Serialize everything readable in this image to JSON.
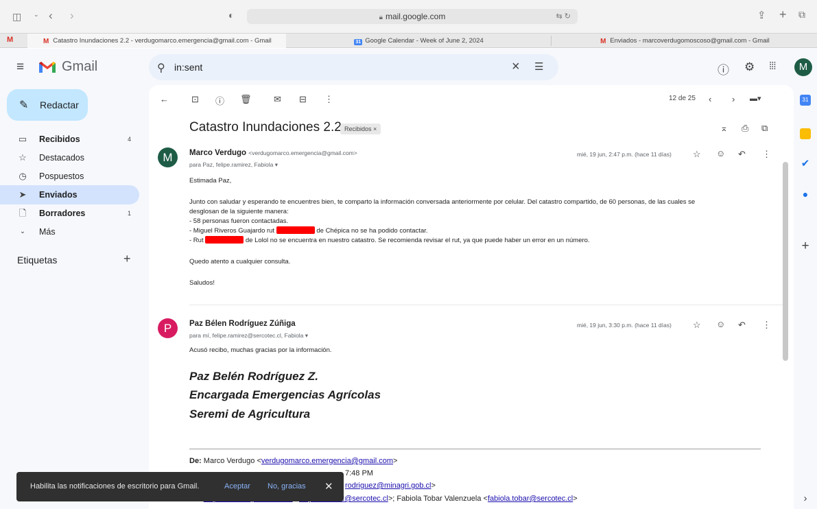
{
  "browser": {
    "url": "mail.google.com",
    "tabs": [
      {
        "title": "Catastro Inundaciones 2.2 - verdugomarco.emergencia@gmail.com - Gmail"
      },
      {
        "title": "Google Calendar - Week of June 2, 2024"
      },
      {
        "title": "Enviados - marcoverdugomoscoso@gmail.com - Gmail"
      }
    ]
  },
  "gmail": {
    "app_name": "Gmail",
    "search_query": "in:sent",
    "account_initial": "M",
    "compose_label": "Redactar",
    "nav": [
      {
        "label": "Recibidos",
        "count": "4"
      },
      {
        "label": "Destacados",
        "count": ""
      },
      {
        "label": "Pospuestos",
        "count": ""
      },
      {
        "label": "Enviados",
        "count": ""
      },
      {
        "label": "Borradores",
        "count": "1"
      },
      {
        "label": "Más",
        "count": ""
      }
    ],
    "labels_header": "Etiquetas"
  },
  "thread": {
    "pagination": "12 de 25",
    "subject": "Catastro Inundaciones 2.2",
    "label_badge": "Recibidos ×",
    "messages": [
      {
        "initial": "M",
        "avatar_color": "#1e5c46",
        "sender_name": "Marco Verdugo",
        "sender_email": "<verdugomarco.emergencia@gmail.com>",
        "to": "para Paz, felipe.ramirez, Fabiola",
        "date": "mié, 19 jun, 2:47 p.m. (hace 11 días)",
        "greeting": "Estimada Paz,",
        "para1": "Junto con saludar y esperando te encuentres bien, te comparto la información conversada anteriormente por celular. Del catastro compartido, de 60 personas, de las cuales se",
        "para1b": "desglosan de la siguiente manera:",
        "bullet1": "- 58 personas fueron contactadas.",
        "bullet2_a": "- Miguel Riveros Guajardo rut",
        "bullet2_b": "de Chépica no se ha podido contactar.",
        "bullet3_a": "- Rut",
        "bullet3_b": "de Lolol no se encuentra en nuestro catastro. Se recomienda revisar el rut, ya que puede haber un error en un número.",
        "closing": "Quedo atento a cualquier consulta.",
        "signoff": "Saludos!"
      },
      {
        "initial": "P",
        "avatar_color": "#d81b60",
        "sender_name": "Paz Bélen Rodríguez Zúñiga",
        "to": "para mí, felipe.ramirez@sercotec.cl, Fabiola",
        "date": "mié, 19 jun, 3:30 p.m. (hace 11 días)",
        "text": "Acusó recibo, muchas gracias por la información.",
        "sig1": "Paz Belén Rodríguez Z.",
        "sig2": "Encargada Emergencias Agrícolas",
        "sig3": "Seremi de Agricultura",
        "quoted_from_label": "De:",
        "quoted_from_name": "Marco Verdugo <",
        "quoted_from_email": "verdugomarco.emergencia@gmail.com",
        "quoted_from_end": ">",
        "quoted_time": "7:48 PM",
        "quoted_to_email": "rodriguez@minagri.gob.cl",
        "quoted_to_end": ">",
        "quoted_cc_label": "Cc:",
        "quoted_cc_email1": "felipe.ramirez@sercotec.cl",
        "quoted_cc_mid": ">; Fabiola Tobar Valenzuela <",
        "quoted_cc_email2": "fabiola.tobar@sercotec.cl",
        "quoted_cc_end": ">"
      }
    ]
  },
  "snackbar": {
    "message": "Habilita las notificaciones de escritorio para Gmail.",
    "accept": "Aceptar",
    "decline": "No, gracias"
  },
  "colors": {
    "gmail_red": "#ea4335",
    "compose_bg": "#c2e7ff",
    "selected_nav": "#d3e3fd",
    "link": "#1a0dab"
  }
}
